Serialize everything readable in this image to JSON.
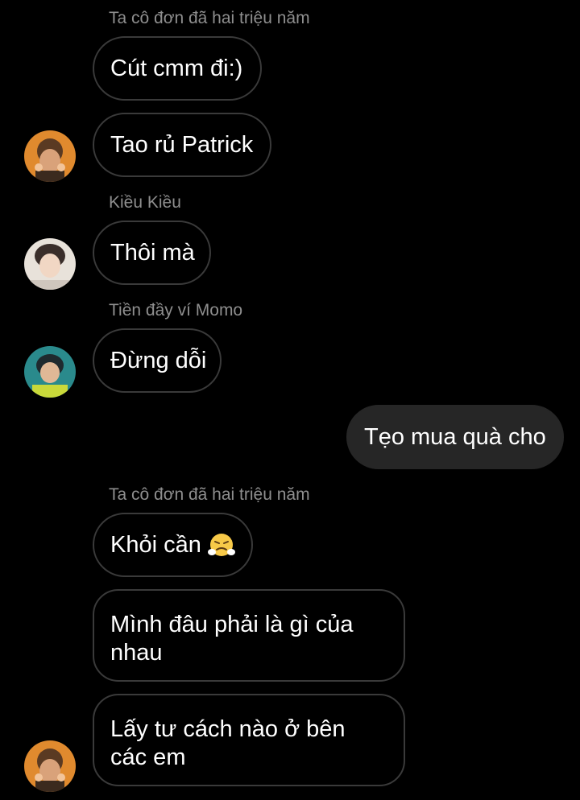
{
  "messages": [
    {
      "type": "sender",
      "name": "Ta cô đơn đã hai triệu năm"
    },
    {
      "type": "in",
      "text": "Cút cmm đi:)"
    },
    {
      "type": "in",
      "text": "Tao rủ Patrick",
      "avatar": "avatar-orange-icon"
    },
    {
      "type": "sender",
      "name": "Kiều Kiều"
    },
    {
      "type": "in",
      "text": "Thôi mà",
      "avatar": "avatar-light-icon"
    },
    {
      "type": "sender",
      "name": "Tiền đầy ví Momo"
    },
    {
      "type": "in",
      "text": "Đừng dỗi",
      "avatar": "avatar-teal-icon"
    },
    {
      "type": "out",
      "text": "Tẹo mua quà cho"
    },
    {
      "type": "sender",
      "name": "Ta cô đơn đã hai triệu năm"
    },
    {
      "type": "in",
      "text": "Khỏi cần",
      "emoji": "steam-from-nose-icon"
    },
    {
      "type": "in",
      "text": "Mình đâu phải là gì của nhau"
    },
    {
      "type": "in",
      "text": "Lấy tư cách nào ở bên các em",
      "avatar": "avatar-orange-icon"
    }
  ],
  "colors": {
    "background": "#000000",
    "sender_name": "#8e8e8e",
    "bubble_border": "#3a3a3a",
    "outgoing_bubble": "#262626",
    "text": "#ffffff"
  }
}
